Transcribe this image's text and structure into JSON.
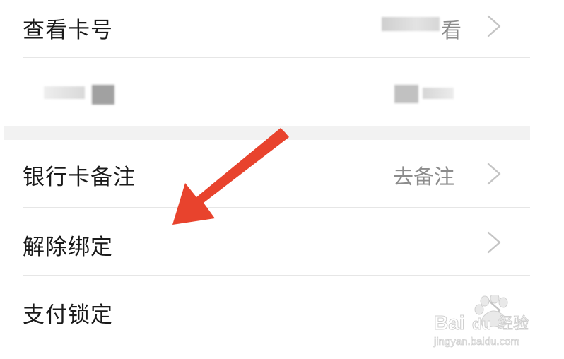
{
  "menu": {
    "items": [
      {
        "label": "查看卡号",
        "value": "看"
      },
      {
        "label": "",
        "value": ""
      },
      {
        "label": "银行卡备注",
        "value": "去备注"
      },
      {
        "label": "解除绑定",
        "value": ""
      },
      {
        "label": "支付锁定",
        "value": ""
      }
    ]
  },
  "watermark": {
    "brand": "Baidu 经验",
    "url": "jingyan.baidu.com"
  },
  "colors": {
    "annotation_arrow": "#e8432d",
    "divider": "#e6e6e6",
    "section_gap": "#f2f2f2",
    "chevron": "#c4c4c4",
    "value_text": "#8c8c8c"
  }
}
